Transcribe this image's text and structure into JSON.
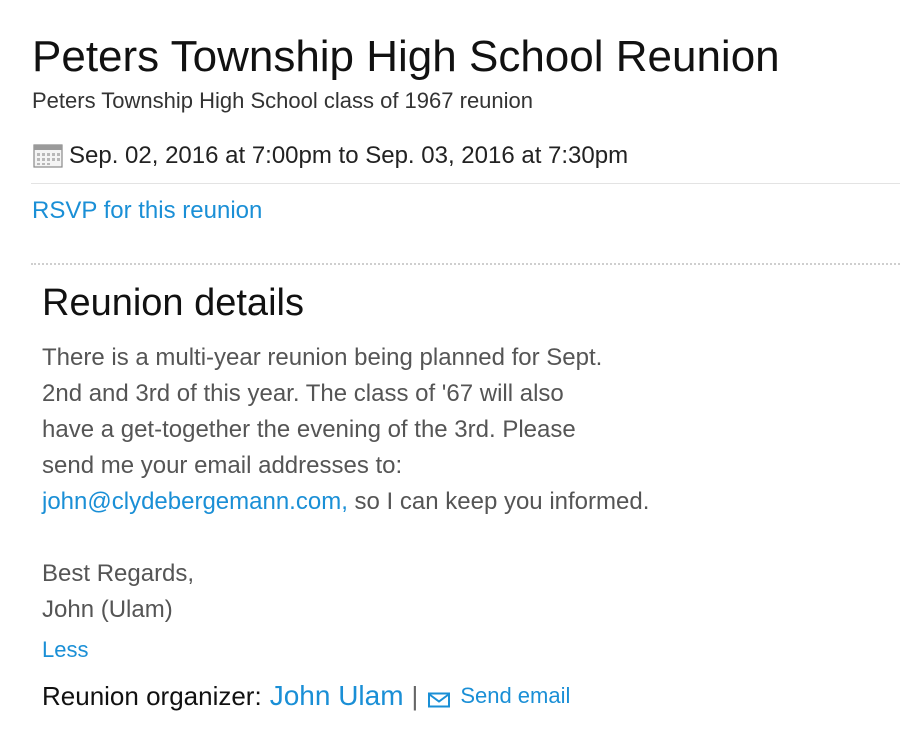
{
  "event": {
    "title": "Peters Township High School Reunion",
    "subtitle": "Peters Township High School class of 1967 reunion",
    "date_range": "Sep. 02, 2016 at 7:00pm to Sep. 03, 2016 at 7:30pm",
    "date_icon": "calendar-icon"
  },
  "rsvp": {
    "label": "RSVP for this reunion"
  },
  "details": {
    "heading": "Reunion details",
    "lines": [
      "There is a multi-year reunion being planned for Sept.",
      "2nd and 3rd of this year. The class of '67 will also",
      "have a get-together the evening of the 3rd. Please",
      "send me your email addresses to:"
    ],
    "email": "john@clydebergemann.com,",
    "email_suffix": " so I can keep you informed.",
    "closing": "Best Regards,",
    "signature": "John (Ulam)",
    "less_label": "Less"
  },
  "organizer": {
    "label": "Reunion organizer:",
    "name": "John Ulam",
    "separator": "|",
    "send_email_label": "Send email",
    "send_email_icon": "mail-icon"
  },
  "colors": {
    "link": "#1a8fd6",
    "text": "#111111",
    "body_text": "#555555"
  }
}
